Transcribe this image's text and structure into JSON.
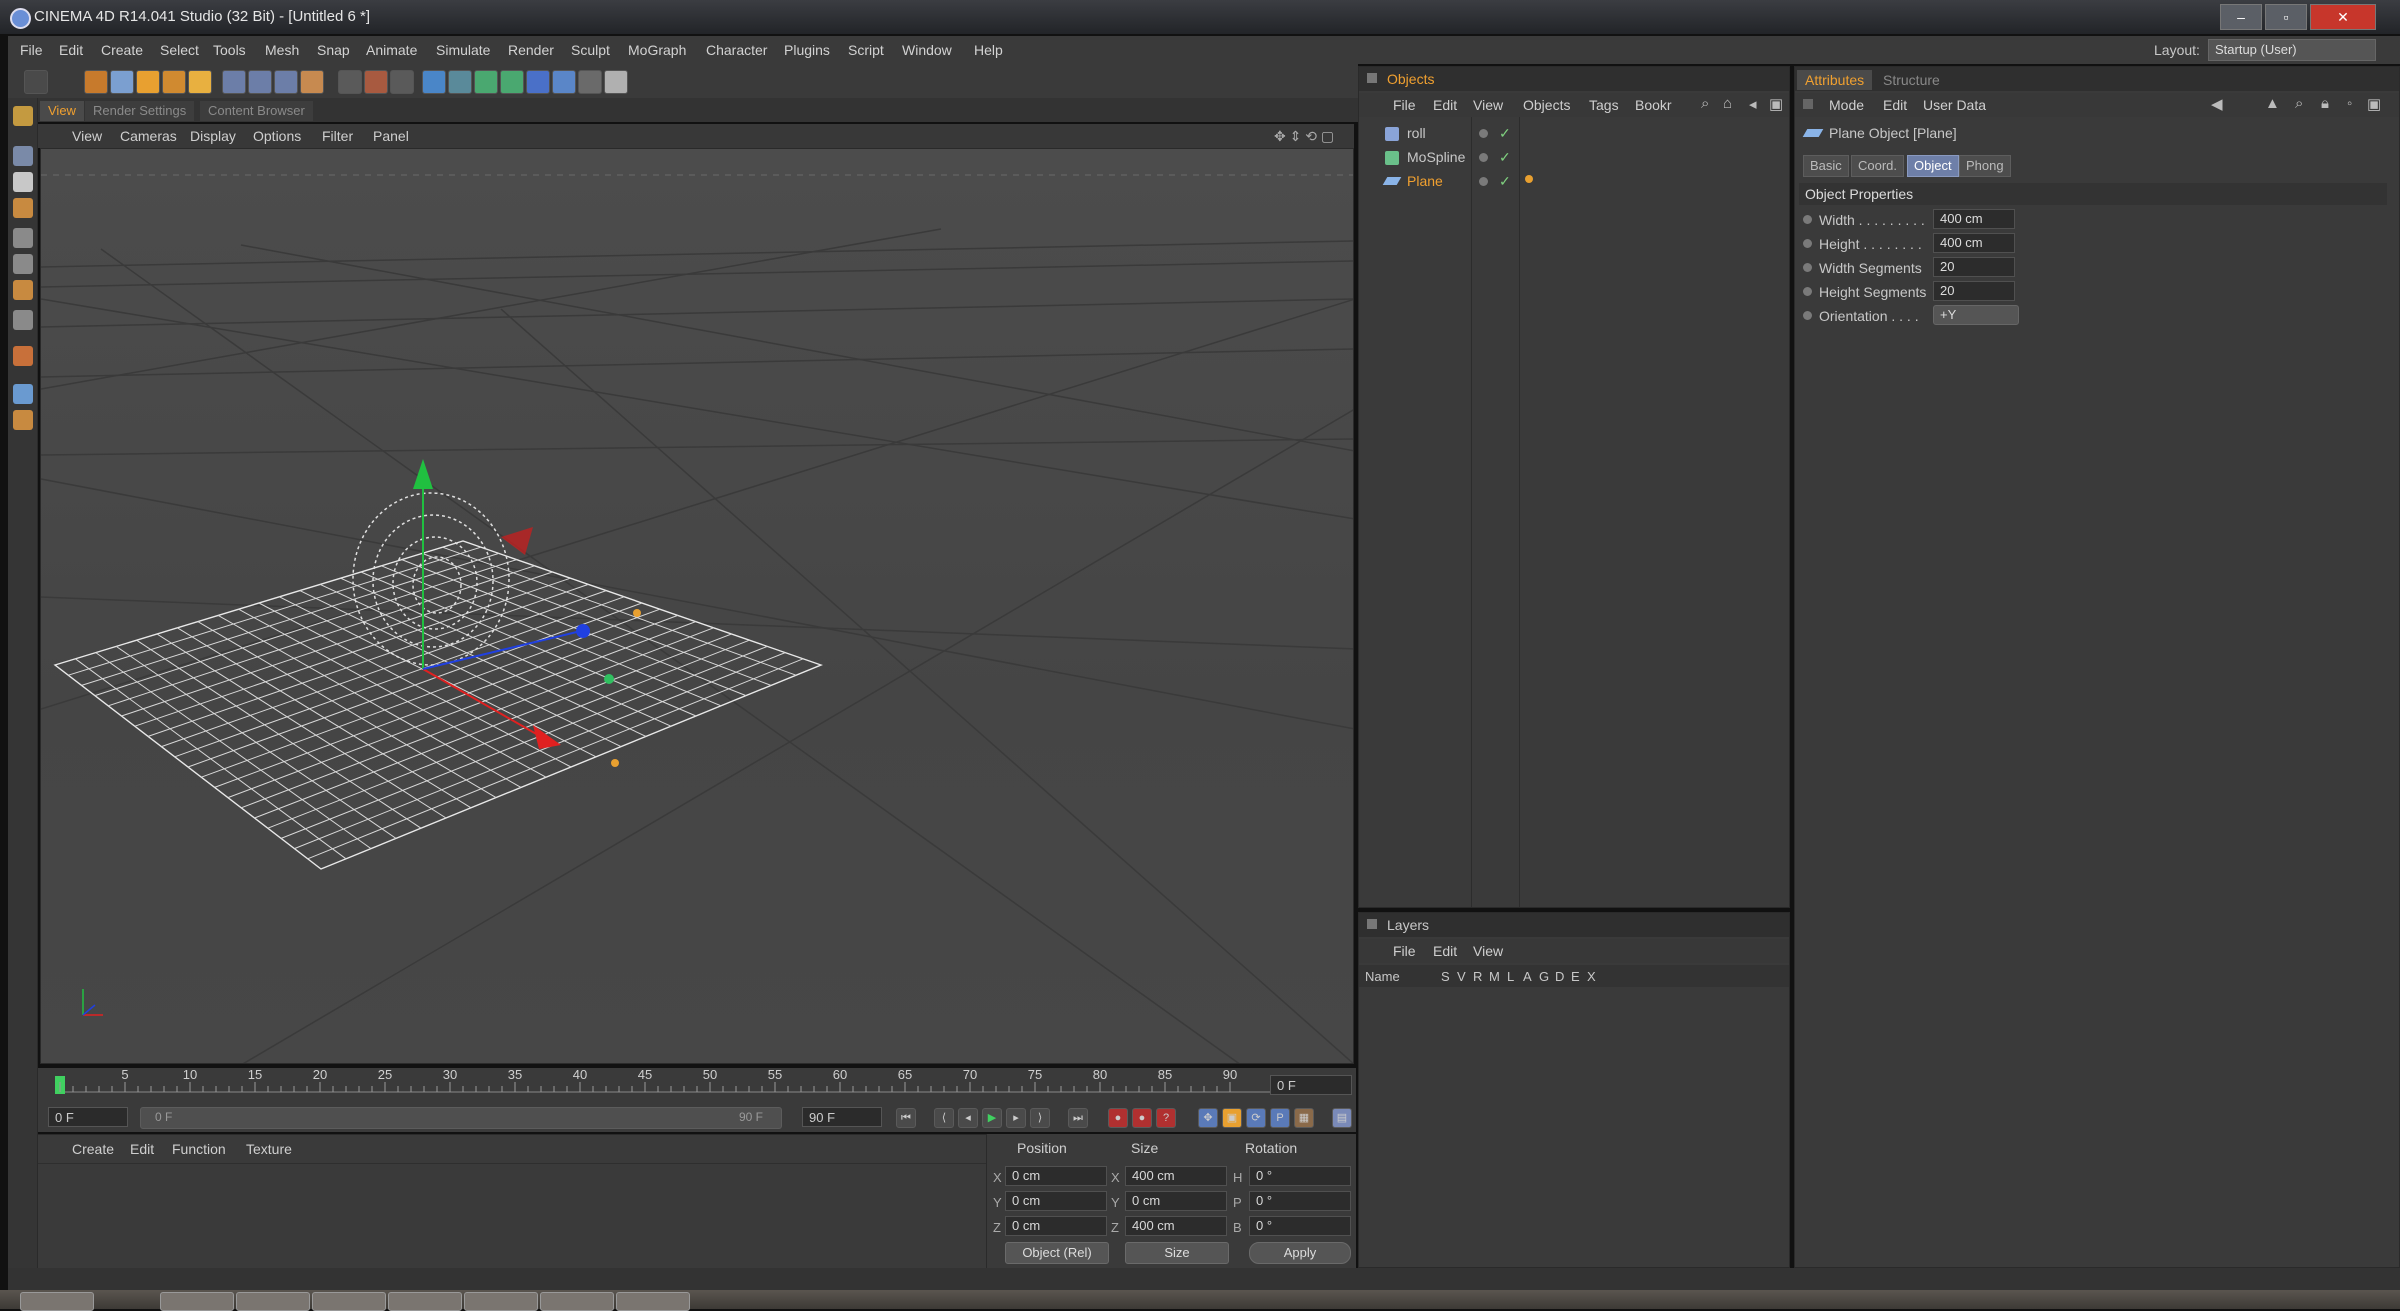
{
  "window": {
    "title": "CINEMA 4D R14.041 Studio (32 Bit) - [Untitled 6 *]",
    "buttons": {
      "minimize": "–",
      "maximize": "▫",
      "close": "✕"
    }
  },
  "menubar": {
    "items": [
      "File",
      "Edit",
      "Create",
      "Select",
      "Tools",
      "Mesh",
      "Snap",
      "Animate",
      "Simulate",
      "Render",
      "Sculpt",
      "MoGraph",
      "Character",
      "Plugins",
      "Script",
      "Window",
      "Help"
    ],
    "layout_label": "Layout:",
    "layout_value": "Startup (User)"
  },
  "viewport": {
    "tabs": [
      "View",
      "Render Settings",
      "Content Browser"
    ],
    "active_tab": "View",
    "menu": [
      "View",
      "Cameras",
      "Display",
      "Options",
      "Filter",
      "Panel"
    ]
  },
  "timeline": {
    "ticks": [
      "0",
      "5",
      "10",
      "15",
      "20",
      "25",
      "30",
      "35",
      "40",
      "45",
      "50",
      "55",
      "60",
      "65",
      "70",
      "75",
      "80",
      "85",
      "90"
    ],
    "current_frame": "0 F",
    "start_frame": "0 F",
    "range_start": "0 F",
    "range_end": "90 F",
    "end_frame": "90 F"
  },
  "material_manager": {
    "menu": [
      "Create",
      "Edit",
      "Function",
      "Texture"
    ]
  },
  "coordinates": {
    "headers": [
      "Position",
      "Size",
      "Rotation"
    ],
    "rows": [
      {
        "axis": "X",
        "pos": "0 cm",
        "size_axis": "X",
        "size": "400 cm",
        "rot_axis": "H",
        "rot": "0 °"
      },
      {
        "axis": "Y",
        "pos": "0 cm",
        "size_axis": "Y",
        "size": "0 cm",
        "rot_axis": "P",
        "rot": "0 °"
      },
      {
        "axis": "Z",
        "pos": "0 cm",
        "size_axis": "Z",
        "size": "400 cm",
        "rot_axis": "B",
        "rot": "0 °"
      }
    ],
    "mode_select": "Object (Rel)",
    "size_select": "Size",
    "apply_label": "Apply"
  },
  "objects": {
    "title": "Objects",
    "menu": [
      "File",
      "Edit",
      "View",
      "Objects",
      "Tags",
      "Bookr"
    ],
    "items": [
      {
        "name": "roll",
        "selected": false
      },
      {
        "name": "MoSpline",
        "selected": false
      },
      {
        "name": "Plane",
        "selected": true
      }
    ]
  },
  "layers": {
    "title": "Layers",
    "menu": [
      "File",
      "Edit",
      "View"
    ],
    "column_name": "Name",
    "flags": [
      "S",
      "V",
      "R",
      "M",
      "L",
      "A",
      "G",
      "D",
      "E",
      "X"
    ]
  },
  "attributes": {
    "tabs": [
      "Attributes",
      "Structure"
    ],
    "menu": [
      "Mode",
      "Edit",
      "User Data"
    ],
    "object_title": "Plane Object [Plane]",
    "subtabs": [
      "Basic",
      "Coord.",
      "Object",
      "Phong"
    ],
    "active_subtab": "Object",
    "section": "Object Properties",
    "properties": [
      {
        "name": "Width . . . . . . . . .",
        "value": "400 cm"
      },
      {
        "name": "Height . . . . . . . .",
        "value": "400 cm"
      },
      {
        "name": "Width Segments",
        "value": "20"
      },
      {
        "name": "Height Segments",
        "value": "20"
      },
      {
        "name": "Orientation . . . .",
        "value": "+Y",
        "dropdown": true
      }
    ]
  },
  "colors": {
    "accent_orange": "#f0a030",
    "selected_blue": "#6e7fa8",
    "axis_x": "#e02020",
    "axis_y": "#20c040",
    "axis_z": "#2040e0"
  }
}
